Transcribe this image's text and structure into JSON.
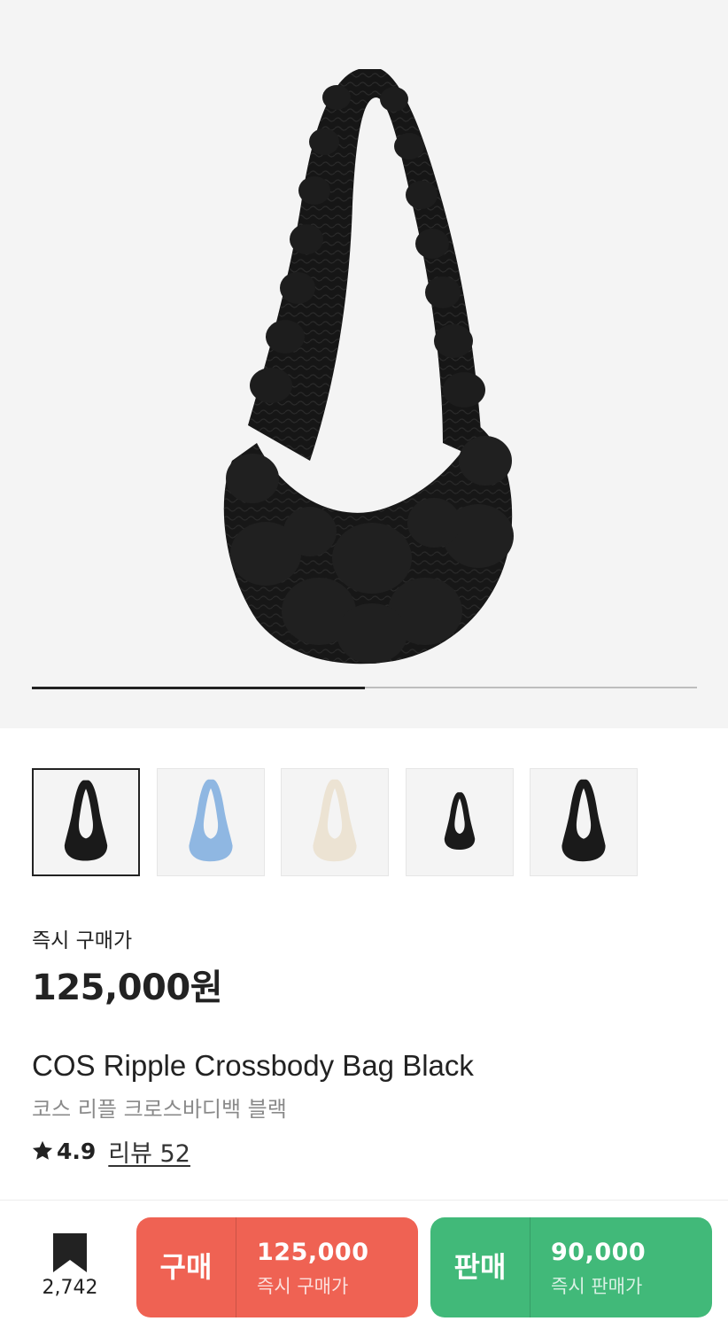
{
  "product": {
    "name_en": "COS Ripple Crossbody Bag Black",
    "name_ko": "코스 리플 크로스바디백 블랙",
    "image_icon": "quilted-crossbody-bag-image",
    "gallery_progress": 0.5
  },
  "thumbnails": [
    {
      "color": "#1a1a1a",
      "selected": true
    },
    {
      "color": "#8fb7e2",
      "selected": false
    },
    {
      "color": "#ece3d3",
      "selected": false
    },
    {
      "color": "#1a1a1a",
      "selected": false
    },
    {
      "color": "#1a1a1a",
      "selected": false
    }
  ],
  "pricing": {
    "label": "즉시 구매가",
    "value": "125,000원"
  },
  "rating": {
    "icon": "star-icon",
    "score": "4.9",
    "reviews_label": "리뷰 52"
  },
  "bottom_bar": {
    "bookmark_icon": "bookmark-icon",
    "bookmark_count": "2,742",
    "buy": {
      "title": "구매",
      "price": "125,000",
      "sub": "즉시 구매가",
      "color": "#ef6253"
    },
    "sell": {
      "title": "판매",
      "price": "90,000",
      "sub": "즉시 판매가",
      "color": "#41b979"
    }
  }
}
